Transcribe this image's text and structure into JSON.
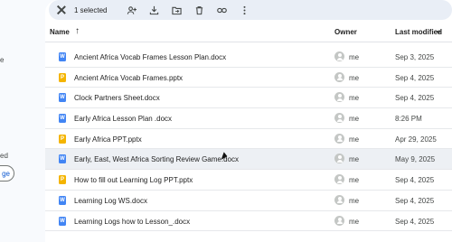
{
  "left_panel": {
    "text1": "e",
    "text2": "ed",
    "button_label": "ge"
  },
  "selection_bar": {
    "count_label": "1 selected"
  },
  "icons": {
    "close": "close-icon",
    "share": "add-person-icon",
    "download": "download-icon",
    "move": "move-folder-icon",
    "trash": "trash-icon",
    "link": "link-icon",
    "more": "more-vert-icon"
  },
  "header": {
    "name": "Name",
    "sort_arrow": "↑",
    "owner": "Owner",
    "modified": "Last modified"
  },
  "colors": {
    "word": "#4285f4",
    "slides": "#f4b400",
    "selection_bar": "#e9eef6"
  },
  "files": [
    {
      "type": "W",
      "name": "Ancient Africa Vocab Frames Lesson Plan.docx",
      "owner": "me",
      "modified": "Sep 3, 2025"
    },
    {
      "type": "P",
      "name": "Ancient Africa Vocab Frames.pptx",
      "owner": "me",
      "modified": "Sep 4, 2025"
    },
    {
      "type": "W",
      "name": "Clock Partners Sheet.docx",
      "owner": "me",
      "modified": "Sep 4, 2025"
    },
    {
      "type": "W",
      "name": "Early Africa Lesson Plan .docx",
      "owner": "me",
      "modified": "8:26 PM"
    },
    {
      "type": "P",
      "name": "Early Africa PPT.pptx",
      "owner": "me",
      "modified": "Apr 29, 2025"
    },
    {
      "type": "W",
      "name": "Early, East, West Africa Sorting Review Game.docx",
      "owner": "me",
      "modified": "May 9, 2025"
    },
    {
      "type": "P",
      "name": "How to fill out Learning Log PPT.pptx",
      "owner": "me",
      "modified": "Sep 4, 2025"
    },
    {
      "type": "W",
      "name": "Learning Log WS.docx",
      "owner": "me",
      "modified": "Sep 4, 2025"
    },
    {
      "type": "W",
      "name": "Learning Logs how to Lesson_.docx",
      "owner": "me",
      "modified": "Sep 4, 2025"
    }
  ]
}
